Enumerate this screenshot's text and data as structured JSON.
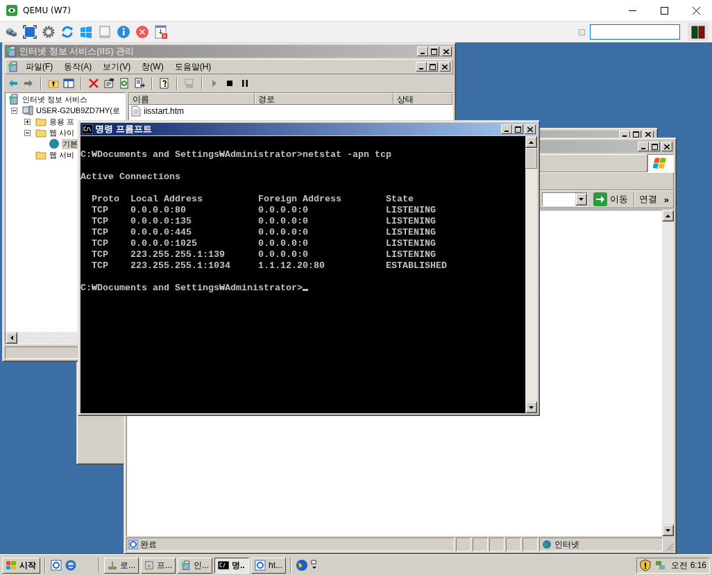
{
  "qemu": {
    "title": "QEMU (W7)"
  },
  "iis_window": {
    "title": "인터넷 정보 서비스(IIS) 관리",
    "active": false,
    "menu": [
      "파일(F)",
      "동작(A)",
      "보기(V)",
      "창(W)",
      "도움말(H)"
    ],
    "tree": [
      {
        "label": "인터넷 정보 서비스",
        "kind": "root",
        "selected": false,
        "children": [
          {
            "label": "USER-G2UB9ZD7HY(로",
            "kind": "server",
            "expanded": true,
            "selected": false,
            "children": [
              {
                "label": "응용 프",
                "kind": "folder",
                "expanded": false,
                "selected": false
              },
              {
                "label": "웹 사이",
                "kind": "folder",
                "expanded": true,
                "selected": false,
                "children": [
                  {
                    "label": "기본",
                    "kind": "site",
                    "selected": true
                  }
                ]
              },
              {
                "label": "웹 서비",
                "kind": "folder",
                "selected": false
              }
            ]
          }
        ]
      }
    ],
    "list": {
      "columns": [
        "이름",
        "경로",
        "상태"
      ],
      "rows": [
        {
          "name": "iisstart.htm"
        }
      ]
    }
  },
  "ie_back_window": {
    "active": false
  },
  "ie_window": {
    "active": false,
    "go_button": "이동",
    "links_label": "연결",
    "links_more": "»",
    "status": "완료",
    "zone": "인터넷"
  },
  "cmd_window": {
    "title": "명령 프롬프트",
    "active": true,
    "console": {
      "command_line": "C:₩Documents and Settings₩Administrator>netstat -apn tcp",
      "heading": "Active Connections",
      "columns": [
        "Proto",
        "Local Address",
        "Foreign Address",
        "State"
      ],
      "rows": [
        {
          "proto": "TCP",
          "local": "0.0.0.0:80",
          "foreign": "0.0.0.0:0",
          "state": "LISTENING"
        },
        {
          "proto": "TCP",
          "local": "0.0.0.0:135",
          "foreign": "0.0.0.0:0",
          "state": "LISTENING"
        },
        {
          "proto": "TCP",
          "local": "0.0.0.0:445",
          "foreign": "0.0.0.0:0",
          "state": "LISTENING"
        },
        {
          "proto": "TCP",
          "local": "0.0.0.0:1025",
          "foreign": "0.0.0.0:0",
          "state": "LISTENING"
        },
        {
          "proto": "TCP",
          "local": "223.255.255.1:139",
          "foreign": "0.0.0.0:0",
          "state": "LISTENING"
        },
        {
          "proto": "TCP",
          "local": "223.255.255.1:1034",
          "foreign": "1.1.12.20:80",
          "state": "ESTABLISHED"
        }
      ],
      "final_prompt": "C:₩Documents and Settings₩Administrator>",
      "cursor": true
    }
  },
  "taskbar": {
    "start": "시작",
    "tasks": [
      {
        "label": "로...",
        "kind": "tool",
        "selected": false
      },
      {
        "label": "프...",
        "kind": "setup",
        "selected": false
      },
      {
        "label": "인...",
        "kind": "iis",
        "selected": false
      },
      {
        "label": "명..",
        "kind": "console",
        "selected": true
      },
      {
        "label": "ht...",
        "kind": "browser",
        "selected": false
      }
    ],
    "clock": "오전 6:16"
  }
}
